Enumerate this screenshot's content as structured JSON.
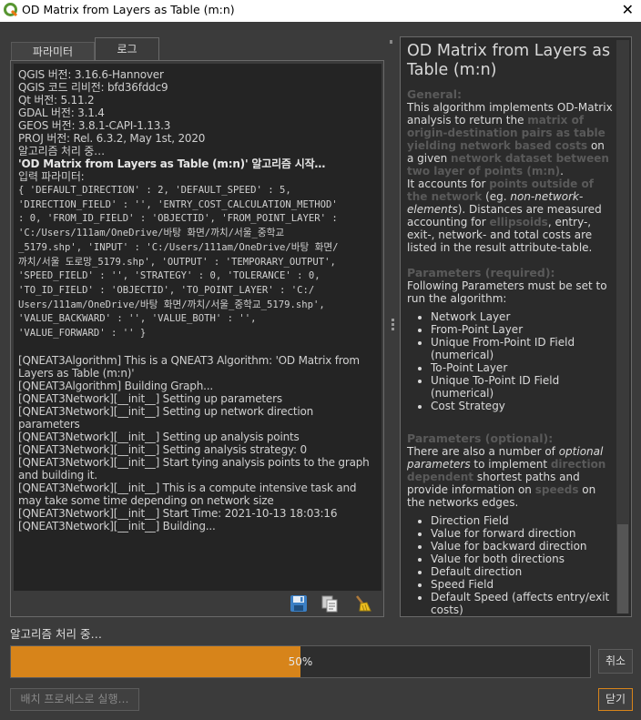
{
  "window": {
    "title": "OD Matrix from Layers as Table (m:n)",
    "close_glyph": "✕"
  },
  "tabs": [
    {
      "label": "파라미터"
    },
    {
      "label": "로그"
    }
  ],
  "log": {
    "header_lines": [
      "QGIS 버전: 3.16.6-Hannover",
      "QGIS 코드 리비전: bfd36fddc9",
      "Qt 버전: 5.11.2",
      "GDAL 버전: 3.1.4",
      "GEOS 버전: 3.8.1-CAPI-1.13.3",
      "PROJ 버전: Rel. 6.3.2, May 1st, 2020",
      "알고리즘 처리 중…"
    ],
    "start_line": "'OD Matrix from Layers as Table (m:n)' 알고리즘 시작…",
    "input_label": "입력 파라미터:",
    "params_lines": [
      "{ 'DEFAULT_DIRECTION' : 2, 'DEFAULT_SPEED' : 5,",
      "'DIRECTION_FIELD' : '', 'ENTRY_COST_CALCULATION_METHOD'",
      ": 0, 'FROM_ID_FIELD' : 'OBJECTID', 'FROM_POINT_LAYER' :",
      "'C:/Users/111am/OneDrive/바탕 화면/까치/서울_중학교",
      "_5179.shp', 'INPUT' : 'C:/Users/111am/OneDrive/바탕 화면/",
      "까치/서울 도로망_5179.shp', 'OUTPUT' : 'TEMPORARY_OUTPUT',",
      "'SPEED_FIELD' : '', 'STRATEGY' : 0, 'TOLERANCE' : 0,",
      "'TO_ID_FIELD' : 'OBJECTID', 'TO_POINT_LAYER' : 'C:/",
      "Users/111am/OneDrive/바탕 화면/까치/서울_중학교_5179.shp',",
      "'VALUE_BACKWARD' : '', 'VALUE_BOTH' : '',",
      "'VALUE_FORWARD' : '' }"
    ],
    "qneat_lines": [
      "[QNEAT3Algorithm] This is a QNEAT3 Algorithm: 'OD Matrix from Layers as Table (m:n)'",
      "[QNEAT3Algorithm] Building Graph...",
      "[QNEAT3Network][__init__] Setting up parameters",
      "[QNEAT3Network][__init__] Setting up network direction parameters",
      "[QNEAT3Network][__init__] Setting up analysis points",
      "[QNEAT3Network][__init__] Setting analysis strategy: 0",
      "[QNEAT3Network][__init__] Start tying analysis points to the graph and building it.",
      "[QNEAT3Network][__init__] This is a compute intensive task and may take some time depending on network size",
      "[QNEAT3Network][__init__] Start Time: 2021-10-13 18:03:16",
      "[QNEAT3Network][__init__] Building..."
    ]
  },
  "help": {
    "title": "OD Matrix from Layers as Table (m:n)",
    "general_heading": "General:",
    "p1_a": "This algorithm implements OD-Matrix analysis to return the ",
    "p1_hl": "matrix of origin-destination pairs as table yielding network based costs",
    "p1_b": " on a given ",
    "p1_hl2": "network dataset between two layer of points (m:n)",
    "p1_c": ".",
    "p2_a": "It accounts for ",
    "p2_hl": "points outside of the network",
    "p2_b": " (eg. ",
    "p2_em": "non-network-elements",
    "p2_c": "). Distances are measured accounting for ",
    "p2_hl2": "ellipsoids",
    "p2_d": ", entry-, exit-, network- and total costs are listed in the result attribute-table.",
    "req_heading": "Parameters (required):",
    "req_intro": "Following Parameters must be set to run the algorithm:",
    "req_items": [
      "Network Layer",
      "From-Point Layer",
      "Unique From-Point ID Field (numerical)",
      "To-Point Layer",
      "Unique To-Point ID Field (numerical)",
      "Cost Strategy"
    ],
    "opt_heading": "Parameters (optional):",
    "opt_a": "There are also a number of ",
    "opt_em": "optional parameters",
    "opt_b": " to implement ",
    "opt_hl": "direction dependent",
    "opt_c": " shortest paths and provide information on ",
    "opt_hl2": "speeds",
    "opt_d": " on the networks edges.",
    "opt_items": [
      "Direction Field",
      "Value for forward direction",
      "Value for backward direction",
      "Value for both directions",
      "Default direction",
      "Speed Field",
      "Default Speed (affects entry/exit costs)"
    ]
  },
  "status_text": "알고리즘 처리 중…",
  "progress": {
    "value": 50,
    "label": "50%",
    "color": "#d7841a"
  },
  "buttons": {
    "cancel": "취소",
    "batch": "배치 프로세스로 실행…",
    "close": "닫기"
  },
  "log_tools": [
    "save-icon",
    "copy-icon",
    "clear-icon"
  ]
}
